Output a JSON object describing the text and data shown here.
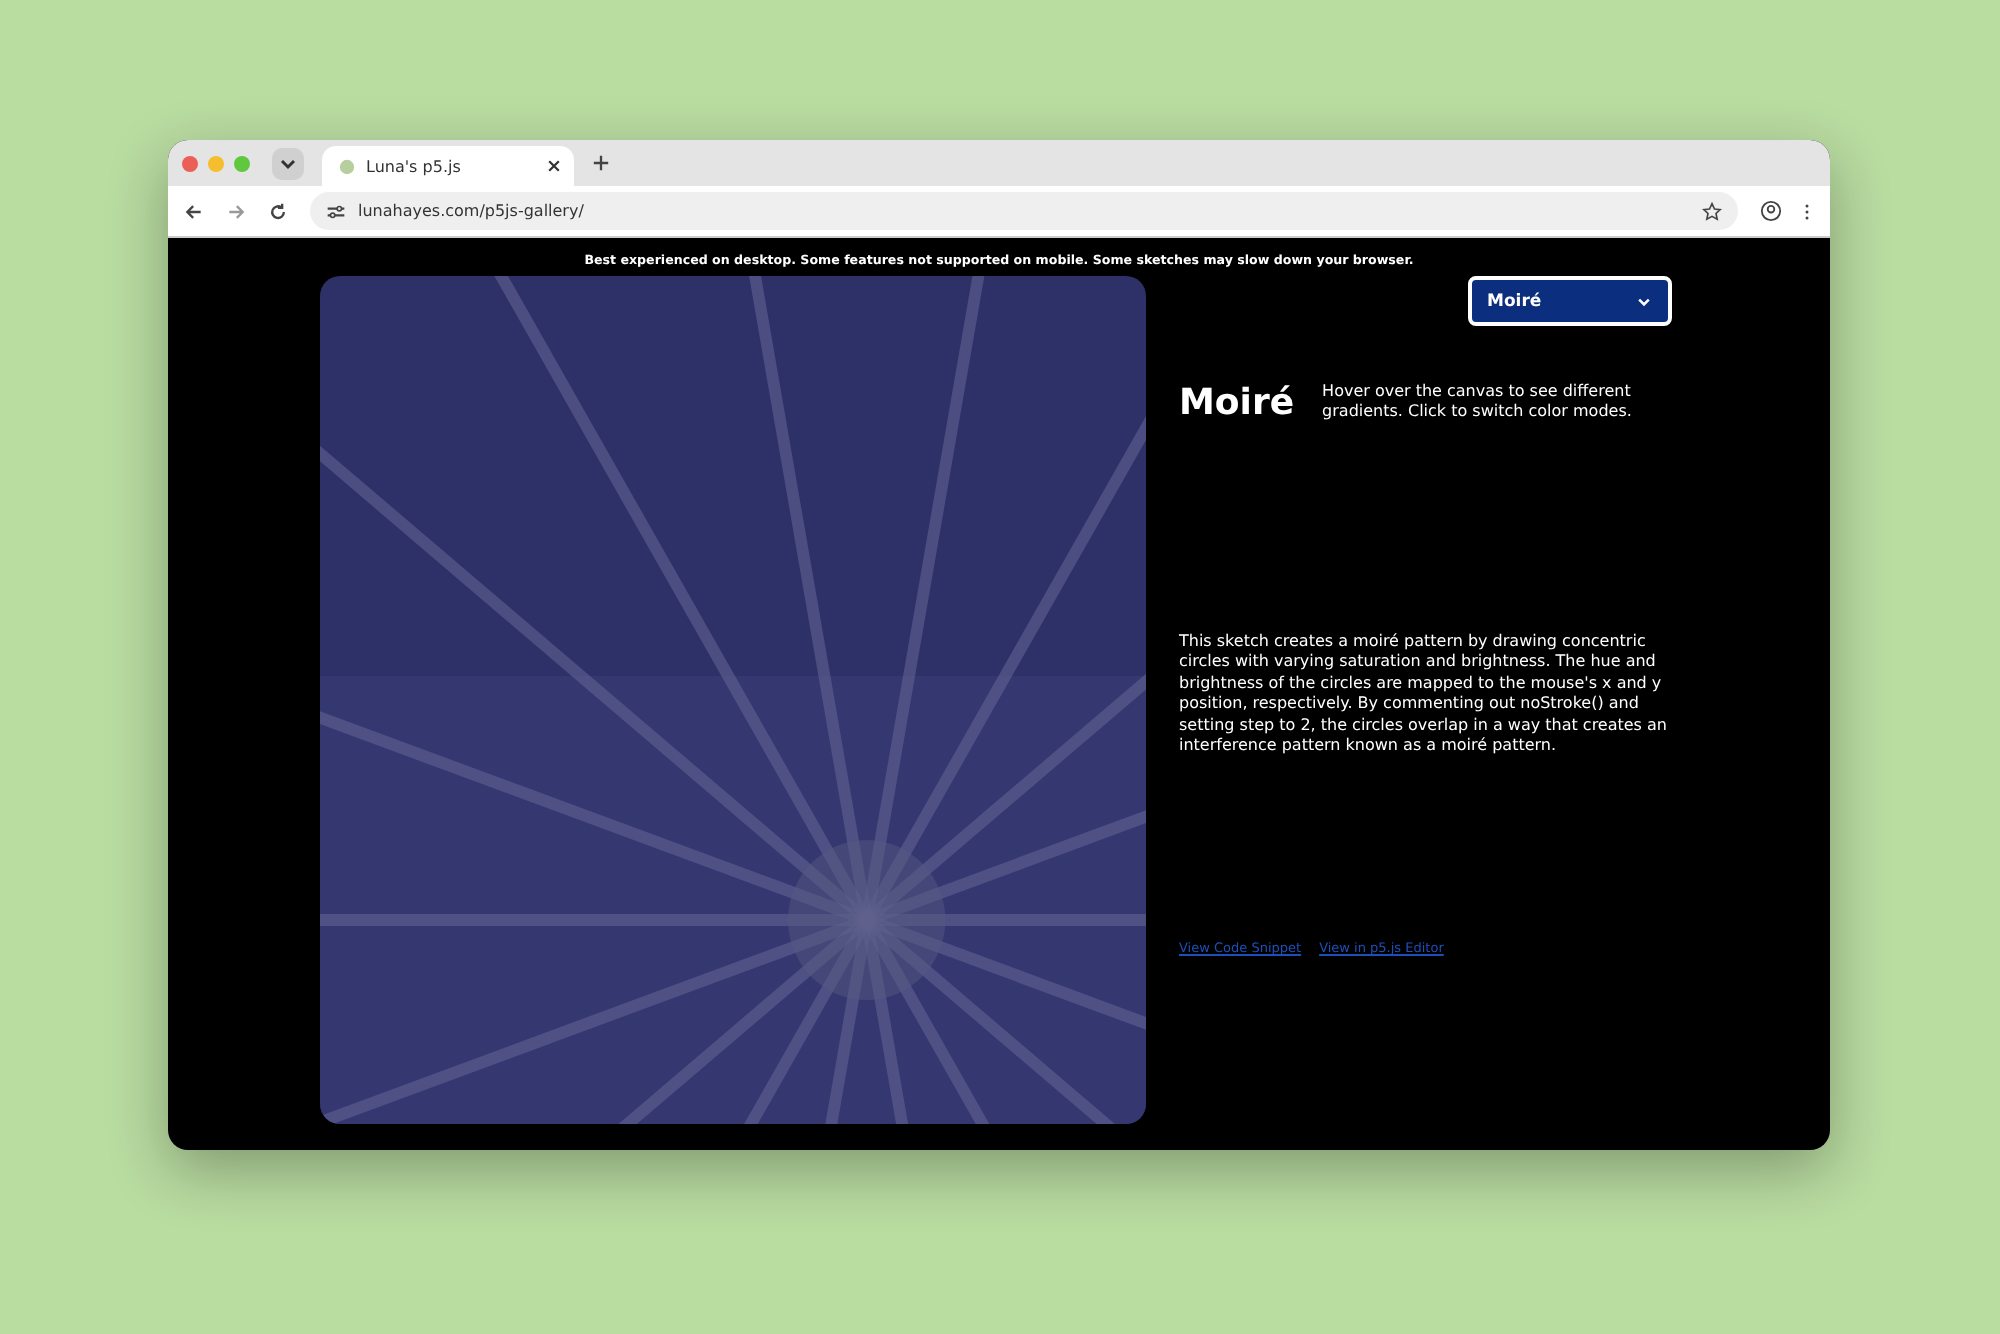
{
  "browser": {
    "tab_title": "Luna's p5.js",
    "url": "lunahayes.com/p5js-gallery/"
  },
  "page": {
    "notice": "Best experienced on desktop. Some features not supported on mobile. Some sketches may slow down your browser.",
    "sketch_select": {
      "value": "Moiré"
    },
    "title": "Moiré",
    "hint": "Hover over the canvas to see different gradients. Click to switch color modes.",
    "description": "This sketch creates a moiré pattern by drawing concentric circles with varying saturation and brightness. The hue and brightness of the circles are mapped to the mouse's x and y position, respectively. By commenting out noStroke() and setting step to 2, the circles overlap in a way that creates an interference pattern known as a moiré pattern.",
    "links": [
      "View Code Snippet",
      "View in p5.js Editor"
    ]
  }
}
